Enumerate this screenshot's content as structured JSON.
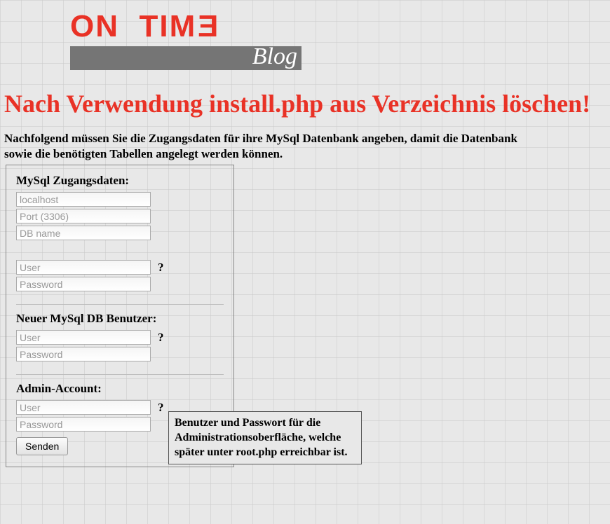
{
  "logo": {
    "brand_on": "ON",
    "brand_tim": "TIM",
    "blog": "Blog"
  },
  "heading": "Nach Verwendung install.php aus Verzeichnis löschen!",
  "intro": "Nachfolgend müssen Sie die Zugangsdaten für ihre MySql Datenbank angeben, damit die Datenbank sowie die benötigten Tabellen angelegt werden können.",
  "form": {
    "mysql": {
      "label": "MySql Zugangsdaten:",
      "host_ph": "localhost",
      "port_ph": "Port (3306)",
      "dbname_ph": "DB name",
      "user_ph": "User",
      "password_ph": "Password"
    },
    "newuser": {
      "label": "Neuer MySql DB Benutzer:",
      "user_ph": "User",
      "password_ph": "Password"
    },
    "admin": {
      "label": "Admin-Account:",
      "user_ph": "User",
      "password_ph": "Password"
    },
    "help_mark": "?",
    "submit": "Senden"
  },
  "tooltip": "Benutzer und Passwort für die Administrationsoberfläche, welche später unter root.php erreichbar ist."
}
